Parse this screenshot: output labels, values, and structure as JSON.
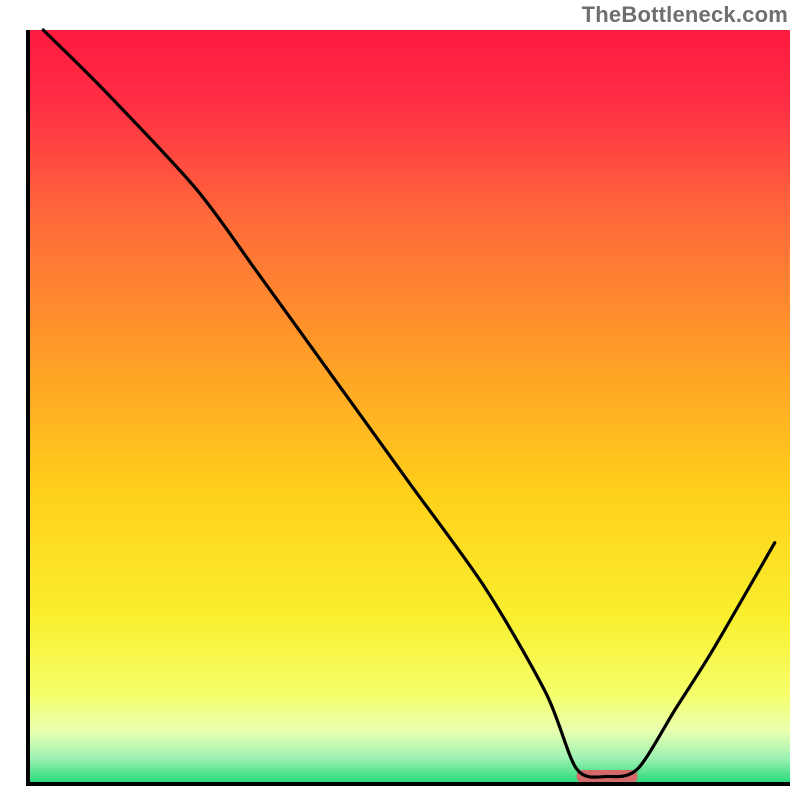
{
  "watermark": "TheBottleneck.com",
  "chart_data": {
    "type": "line",
    "title": "",
    "xlabel": "",
    "ylabel": "",
    "xlim": [
      0,
      100
    ],
    "ylim": [
      0,
      100
    ],
    "grid": false,
    "legend": false,
    "annotations": [],
    "series": [
      {
        "name": "bottleneck-curve",
        "description": "V-shaped bottleneck curve; minimum near x≈76, y≈1. Short flat sweet-spot segment around x 72–80.",
        "x": [
          2,
          10,
          22,
          30,
          40,
          50,
          60,
          68,
          72,
          76,
          80,
          85,
          90,
          98
        ],
        "y": [
          100,
          92,
          79,
          68,
          54,
          40,
          26,
          12,
          2,
          1,
          2,
          10,
          18,
          32
        ]
      }
    ],
    "sweet_spot_marker": {
      "x_center": 76,
      "width": 8,
      "color": "#d46a6a"
    },
    "background_gradient": {
      "stops": [
        {
          "pos": 0.0,
          "color": "#ff1a3f"
        },
        {
          "pos": 0.1,
          "color": "#ff2f45"
        },
        {
          "pos": 0.25,
          "color": "#ff6a3a"
        },
        {
          "pos": 0.45,
          "color": "#ffa226"
        },
        {
          "pos": 0.62,
          "color": "#ffd21a"
        },
        {
          "pos": 0.78,
          "color": "#f9ef2e"
        },
        {
          "pos": 0.88,
          "color": "#f6ff6a"
        },
        {
          "pos": 0.93,
          "color": "#e8ffb0"
        },
        {
          "pos": 0.965,
          "color": "#9ff2b3"
        },
        {
          "pos": 1.0,
          "color": "#22d877"
        }
      ]
    },
    "axes_color": "#000000",
    "line_color": "#000000"
  }
}
